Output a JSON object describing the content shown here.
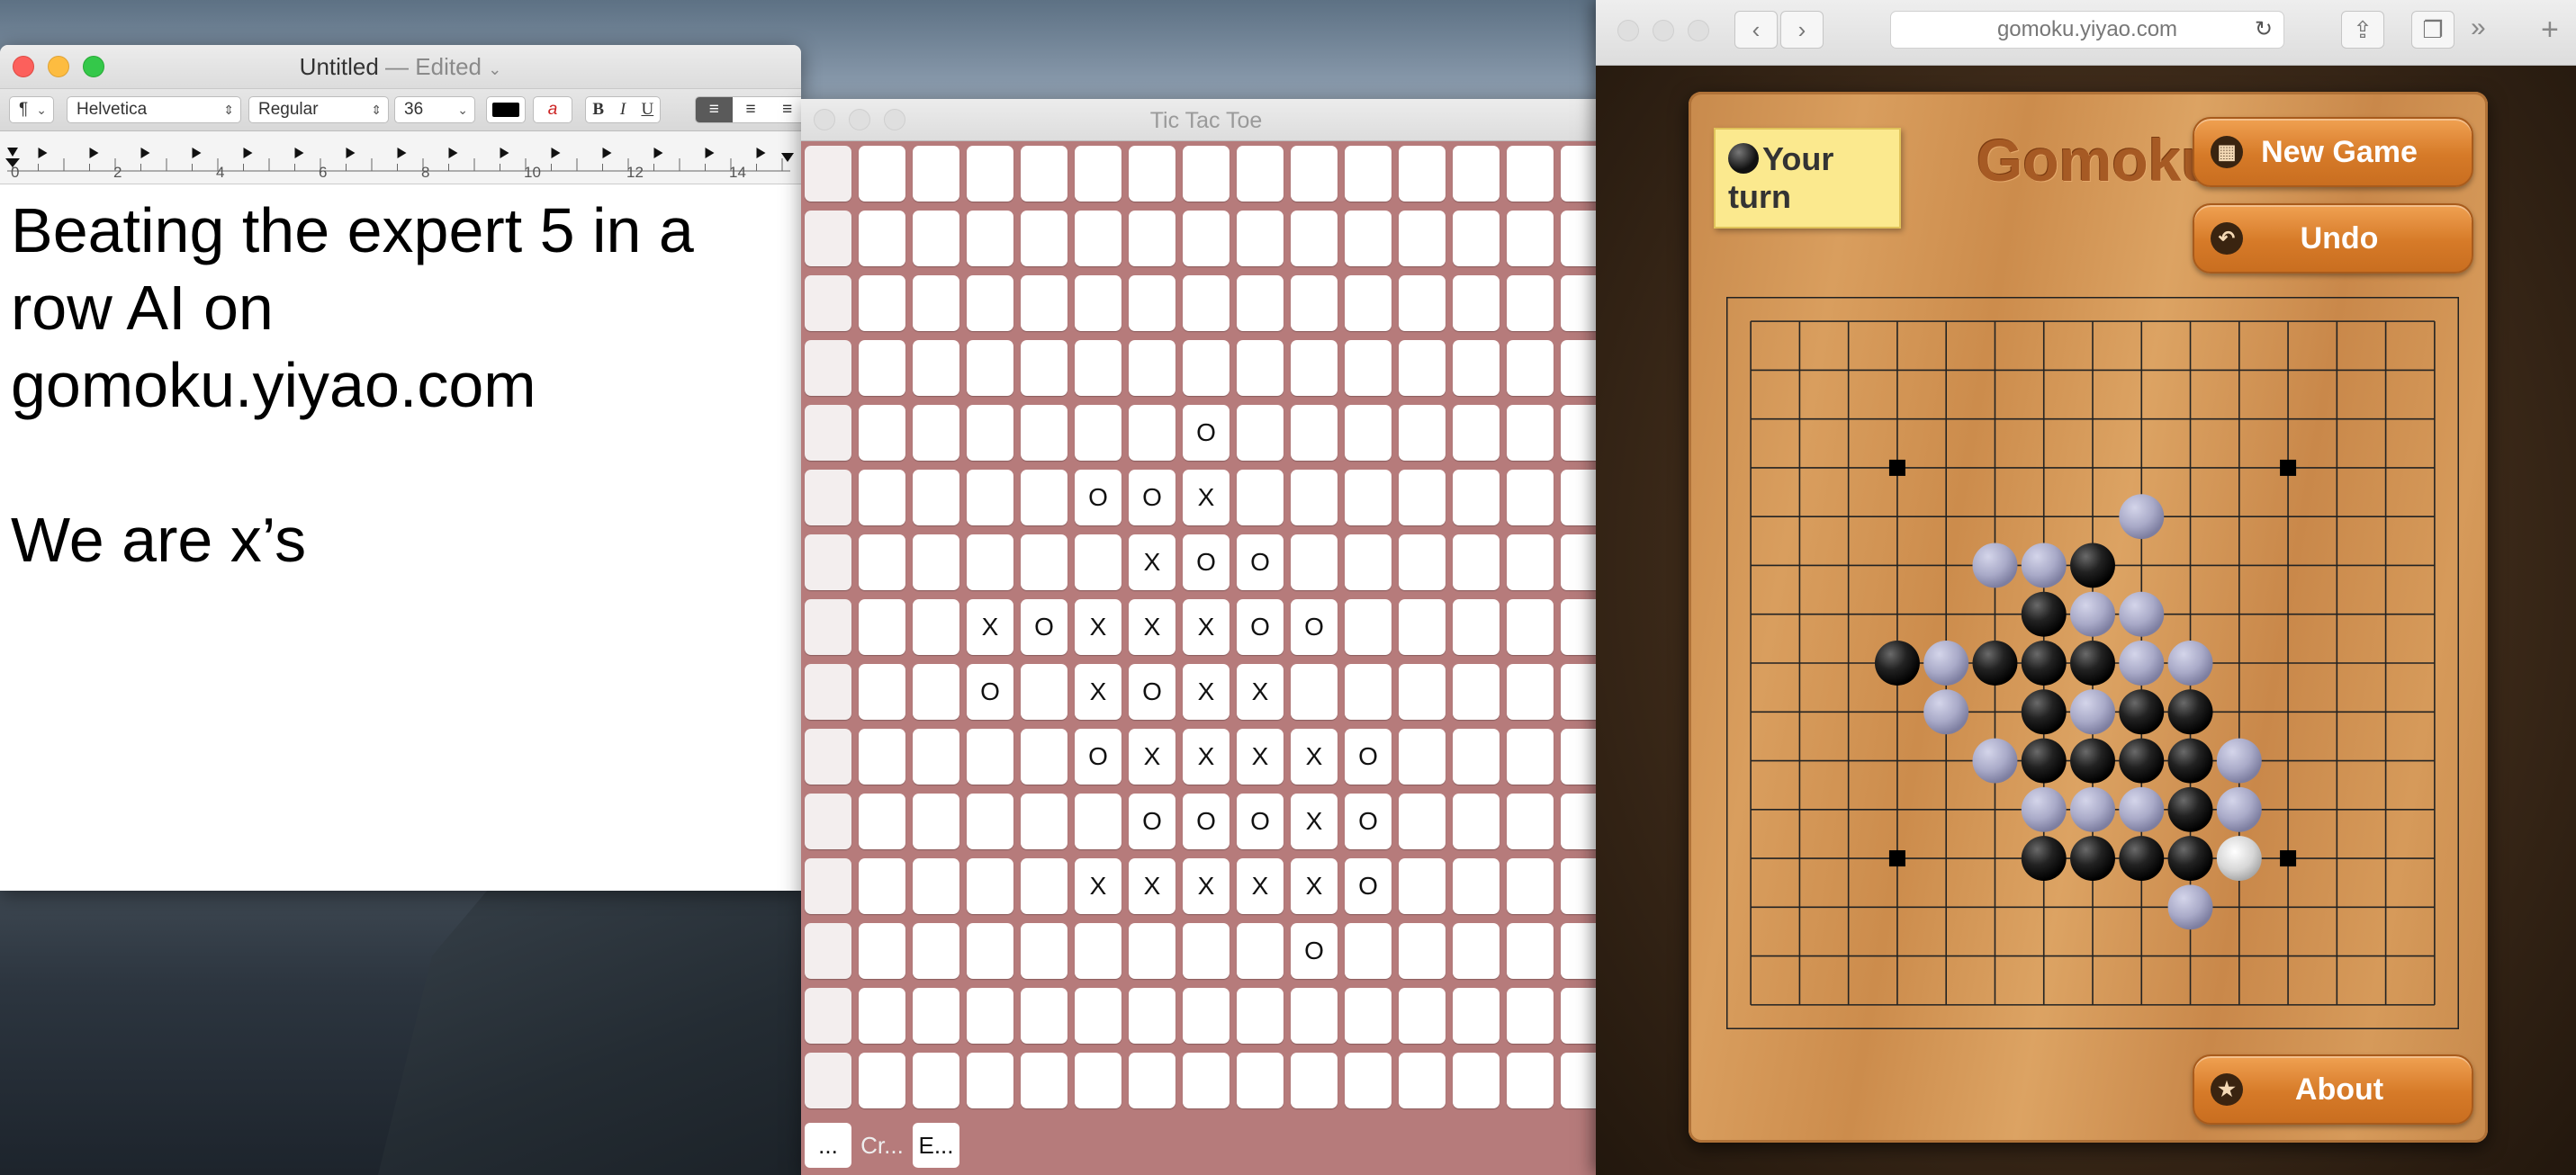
{
  "textedit": {
    "title": "Untitled",
    "edited": " — Edited",
    "chevron": "⌄",
    "paragraph": "¶",
    "font_family": "Helvetica",
    "font_style": "Regular",
    "font_size": "36",
    "bold": "B",
    "italic": "I",
    "underline": "U",
    "ruler_labels": [
      "0",
      "2",
      "4",
      "6",
      "8",
      "10",
      "12",
      "14"
    ],
    "body_lines": [
      "Beating the expert 5 in a",
      "row AI on",
      "gomoku.yiyao.com",
      "",
      "We are x’s"
    ]
  },
  "tictactoe": {
    "title": "Tic Tac Toe",
    "marks": [
      "",
      "",
      "",
      "",
      "       O       ",
      "     OOX       ",
      "      XOO      ",
      "   XOXXXOO     ",
      "   O XOXX      ",
      "     OXXXXO    ",
      "      OOOXO    ",
      "     XXXXXO    ",
      "         O     ",
      "",
      ""
    ],
    "bottom_buttons": [
      "...",
      "Cr...",
      "E..."
    ]
  },
  "safari": {
    "url": "gomoku.yiyao.com",
    "back": "‹",
    "forward": "›",
    "reload": "↻",
    "more": "»",
    "new_tab": "+"
  },
  "gomoku": {
    "turn_text_1": "Your",
    "turn_text_2": "turn",
    "logo": "Gomoku",
    "new_game": "New Game",
    "undo": "Undo",
    "about": "About",
    "board_size": 15,
    "star_points": [
      [
        3,
        3
      ],
      [
        3,
        11
      ],
      [
        11,
        3
      ],
      [
        11,
        11
      ]
    ],
    "black_stones": [
      [
        5,
        7
      ],
      [
        6,
        6
      ],
      [
        7,
        3
      ],
      [
        7,
        5
      ],
      [
        7,
        6
      ],
      [
        7,
        7
      ],
      [
        8,
        6
      ],
      [
        8,
        8
      ],
      [
        8,
        9
      ],
      [
        9,
        6
      ],
      [
        9,
        7
      ],
      [
        9,
        8
      ],
      [
        9,
        9
      ],
      [
        10,
        9
      ],
      [
        11,
        6
      ],
      [
        11,
        7
      ],
      [
        11,
        8
      ],
      [
        11,
        9
      ]
    ],
    "white_stones": [
      [
        4,
        8
      ],
      [
        5,
        5
      ],
      [
        5,
        6
      ],
      [
        6,
        7
      ],
      [
        6,
        8
      ],
      [
        7,
        4
      ],
      [
        7,
        8
      ],
      [
        7,
        9
      ],
      [
        8,
        4
      ],
      [
        8,
        7
      ],
      [
        9,
        5
      ],
      [
        9,
        10
      ],
      [
        10,
        6
      ],
      [
        10,
        7
      ],
      [
        10,
        8
      ],
      [
        10,
        10
      ],
      [
        12,
        9
      ]
    ],
    "last_move": [
      11,
      10
    ],
    "colors": {
      "black_stone": "#1a1a1a",
      "white_stone": "#a9aac8",
      "button": "#d67a28",
      "board": "#d69a5a"
    }
  }
}
